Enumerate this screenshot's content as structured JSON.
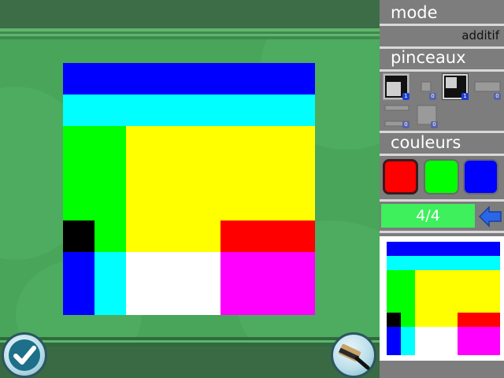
{
  "panel": {
    "mode_label": "mode",
    "mode_value": "additif",
    "brushes_label": "pinceaux",
    "colors_label": "couleurs",
    "counter": "4/4"
  },
  "brushes": [
    {
      "icon": "l-shape-brush-icon",
      "badge": "1",
      "selected": false
    },
    {
      "icon": "small-square-brush-icon",
      "badge": "0",
      "selected": false
    },
    {
      "icon": "corner-brush-icon",
      "badge": "1",
      "selected": true
    },
    {
      "icon": "horizontal-bar-brush-icon",
      "badge": "0",
      "selected": false
    },
    {
      "icon": "thin-bar-brush-icon",
      "badge": "0",
      "selected": false
    },
    {
      "icon": "square-brush-icon",
      "badge": "0",
      "selected": false
    }
  ],
  "swatches": [
    {
      "name": "red",
      "color": "#ff0000",
      "selected": true
    },
    {
      "name": "green",
      "color": "#00ff00",
      "selected": false
    },
    {
      "name": "blue",
      "color": "#0000ff",
      "selected": false
    }
  ],
  "palette": {
    "blue": "#0000ff",
    "cyan": "#00ffff",
    "green": "#00ff00",
    "yellow": "#ffff00",
    "black": "#000000",
    "red": "#ff0000",
    "white": "#ffffff",
    "magenta": "#ff00ff"
  },
  "grid": [
    [
      "blue",
      "blue",
      "blue",
      "blue",
      "blue",
      "blue",
      "blue",
      "blue"
    ],
    [
      "cyan",
      "cyan",
      "cyan",
      "cyan",
      "cyan",
      "cyan",
      "cyan",
      "cyan"
    ],
    [
      "green",
      "green",
      "yellow",
      "yellow",
      "yellow",
      "yellow",
      "yellow",
      "yellow"
    ],
    [
      "green",
      "green",
      "yellow",
      "yellow",
      "yellow",
      "yellow",
      "yellow",
      "yellow"
    ],
    [
      "black",
      "green",
      "yellow",
      "yellow",
      "yellow",
      "red",
      "red",
      "red"
    ],
    [
      "blue",
      "cyan",
      "white",
      "white",
      "white",
      "magenta",
      "magenta",
      "magenta"
    ],
    [
      "blue",
      "cyan",
      "white",
      "white",
      "white",
      "magenta",
      "magenta",
      "magenta"
    ]
  ],
  "icons": {
    "validate": "checkmark-icon",
    "brush": "paintbrush-icon",
    "back": "back-arrow-icon"
  }
}
